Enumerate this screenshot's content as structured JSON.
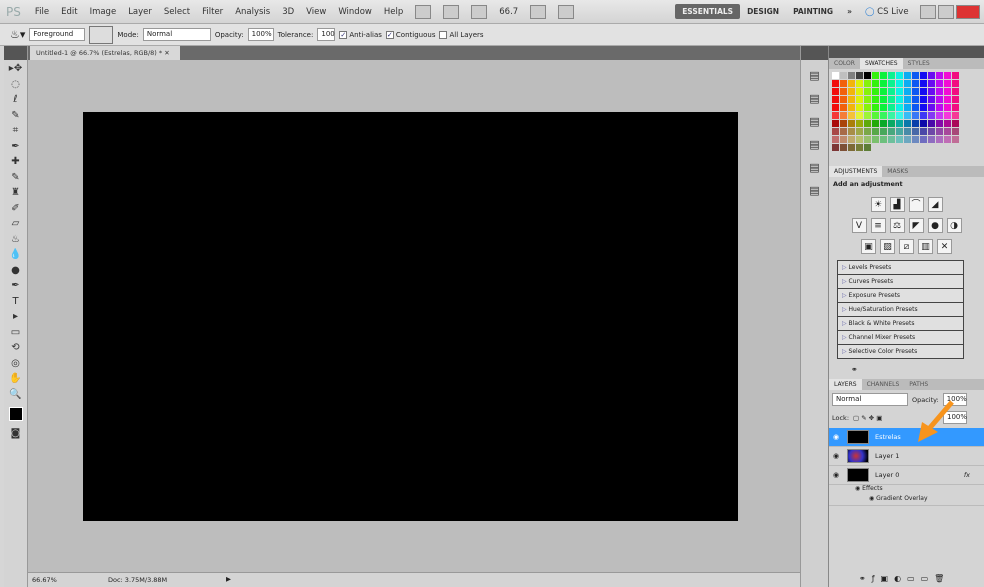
{
  "app": {
    "logo": "PS",
    "menus": [
      "File",
      "Edit",
      "Image",
      "Layer",
      "Select",
      "Filter",
      "Analysis",
      "3D",
      "View",
      "Window",
      "Help"
    ],
    "zoom_field": "66.7",
    "workspaces": [
      "ESSENTIALS",
      "DESIGN",
      "PAINTING"
    ],
    "more": "»",
    "cs_live": "CS Live"
  },
  "options": {
    "fill_source": "Foreground",
    "mode_label": "Mode:",
    "mode": "Normal",
    "opacity_label": "Opacity:",
    "opacity": "100%",
    "tolerance_label": "Tolerance:",
    "tolerance": "100",
    "anti_alias": "Anti-alias",
    "contiguous": "Contiguous",
    "all_layers": "All Layers"
  },
  "document": {
    "tab": "Untitled-1 @ 66.7% (Estrelas, RGB/8) *",
    "status_zoom": "66.67%",
    "status_doc": "Doc: 3.75M/3.88M"
  },
  "color_panel": {
    "tabs": [
      "COLOR",
      "SWATCHES",
      "STYLES"
    ]
  },
  "adjustments": {
    "tabs": [
      "ADJUSTMENTS",
      "MASKS"
    ],
    "heading": "Add an adjustment",
    "presets": [
      "Levels Presets",
      "Curves Presets",
      "Exposure Presets",
      "Hue/Saturation Presets",
      "Black & White Presets",
      "Channel Mixer Presets",
      "Selective Color Presets"
    ]
  },
  "layers": {
    "tabs": [
      "LAYERS",
      "CHANNELS",
      "PATHS"
    ],
    "blend": "Normal",
    "opacity_label": "Opacity:",
    "opacity": "100%",
    "lock_label": "Lock:",
    "fill": "100%",
    "items": [
      {
        "name": "Estrelas",
        "selected": true
      },
      {
        "name": "Layer 1"
      },
      {
        "name": "Layer 0",
        "fx": "fx"
      }
    ],
    "effects": "Effects",
    "effect_items": [
      "Gradient Overlay"
    ]
  },
  "colors": {
    "accent_selected": "#3399ff",
    "arrow": "#f7941d",
    "canvas": "#000000"
  }
}
